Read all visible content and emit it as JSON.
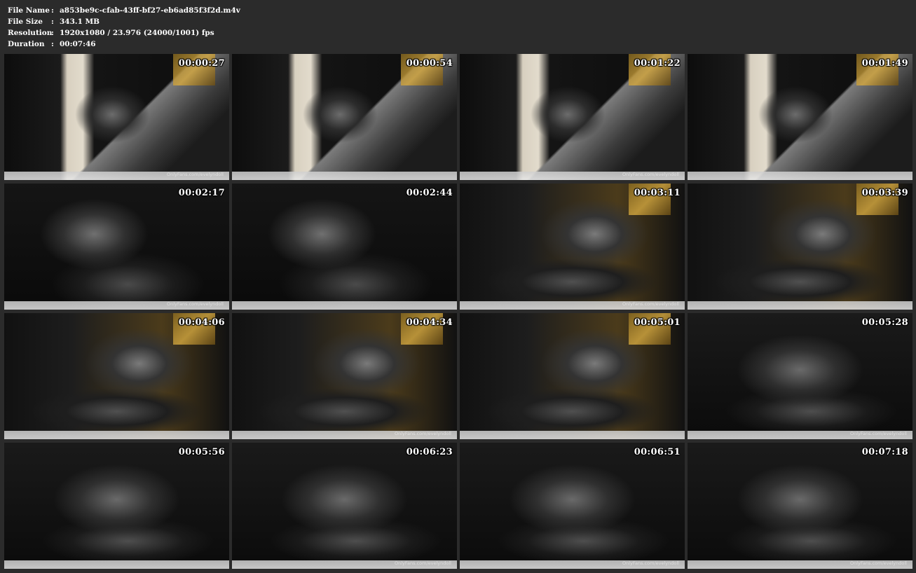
{
  "info": {
    "file_name_label": "File Name",
    "file_name_value": "a853be9c-cfab-43ff-bf27-eb6ad85f3f2d.m4v",
    "file_size_label": "File Size",
    "file_size_value": "343.1 MB",
    "resolution_label": "Resolution",
    "resolution_value": "1920x1080 / 23.976 (24000/1001) fps",
    "duration_label": "Duration",
    "duration_value": "00:07:46",
    "separator": ":"
  },
  "thumbnails": [
    {
      "timestamp": "00:00:27",
      "variant": "v1",
      "watermark": "OnlyFans.com/evelyndoll"
    },
    {
      "timestamp": "00:00:54",
      "variant": "v1",
      "watermark": ""
    },
    {
      "timestamp": "00:01:22",
      "variant": "v1",
      "watermark": "OnlyFans.com/evelyndoll"
    },
    {
      "timestamp": "00:01:49",
      "variant": "v1",
      "watermark": ""
    },
    {
      "timestamp": "00:02:17",
      "variant": "v2",
      "watermark": "OnlyFans.com/evelyndoll"
    },
    {
      "timestamp": "00:02:44",
      "variant": "v2",
      "watermark": ""
    },
    {
      "timestamp": "00:03:11",
      "variant": "v3",
      "watermark": "OnlyFans.com/evelyndoll"
    },
    {
      "timestamp": "00:03:39",
      "variant": "v3",
      "watermark": ""
    },
    {
      "timestamp": "00:04:06",
      "variant": "v3",
      "watermark": ""
    },
    {
      "timestamp": "00:04:34",
      "variant": "v3",
      "watermark": "OnlyFans.com/evelyndoll"
    },
    {
      "timestamp": "00:05:01",
      "variant": "v3",
      "watermark": ""
    },
    {
      "timestamp": "00:05:28",
      "variant": "v4",
      "watermark": "OnlyFans.com/evelyndoll"
    },
    {
      "timestamp": "00:05:56",
      "variant": "v4",
      "watermark": ""
    },
    {
      "timestamp": "00:06:23",
      "variant": "v4",
      "watermark": "OnlyFans.com/evelyndoll"
    },
    {
      "timestamp": "00:06:51",
      "variant": "v4",
      "watermark": "OnlyFans.com/evelyndoll"
    },
    {
      "timestamp": "00:07:18",
      "variant": "v4",
      "watermark": "OnlyFans.com/evelyndoll"
    }
  ]
}
